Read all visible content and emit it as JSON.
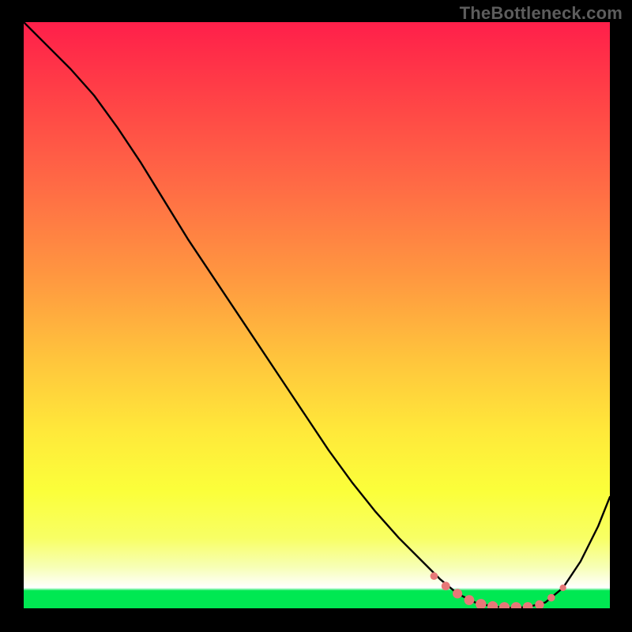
{
  "watermark": "TheBottleneck.com",
  "colors": {
    "curve": "#000000",
    "marker": "#e77878",
    "background_black": "#000000"
  },
  "chart_data": {
    "type": "line",
    "title": "",
    "xlabel": "",
    "ylabel": "",
    "xlim": [
      0,
      100
    ],
    "ylim": [
      0,
      100
    ],
    "grid": false,
    "series": [
      {
        "name": "bottleneck-curve",
        "x": [
          0,
          4,
          8,
          12,
          16,
          20,
          24,
          28,
          32,
          36,
          40,
          44,
          48,
          52,
          56,
          60,
          64,
          68,
          71,
          74,
          77,
          80,
          83,
          86,
          89,
          92,
          95,
          98,
          100
        ],
        "y": [
          100,
          96,
          92,
          87.5,
          82,
          76,
          69.5,
          63,
          57,
          51,
          45,
          39,
          33,
          27,
          21.5,
          16.5,
          12,
          8,
          5,
          2.5,
          1,
          0.3,
          0.1,
          0.2,
          1,
          3.5,
          8,
          14,
          19
        ]
      }
    ],
    "markers": {
      "name": "highlight-dots",
      "color": "#e77878",
      "x": [
        70,
        72,
        74,
        76,
        78,
        80,
        82,
        84,
        86,
        88,
        90,
        92
      ],
      "y": [
        5.5,
        3.8,
        2.5,
        1.4,
        0.7,
        0.3,
        0.15,
        0.15,
        0.2,
        0.6,
        1.8,
        3.5
      ],
      "r": [
        3.0,
        3.4,
        3.8,
        4.0,
        4.2,
        4.2,
        4.2,
        4.2,
        4.0,
        3.6,
        3.0,
        2.6
      ]
    }
  }
}
